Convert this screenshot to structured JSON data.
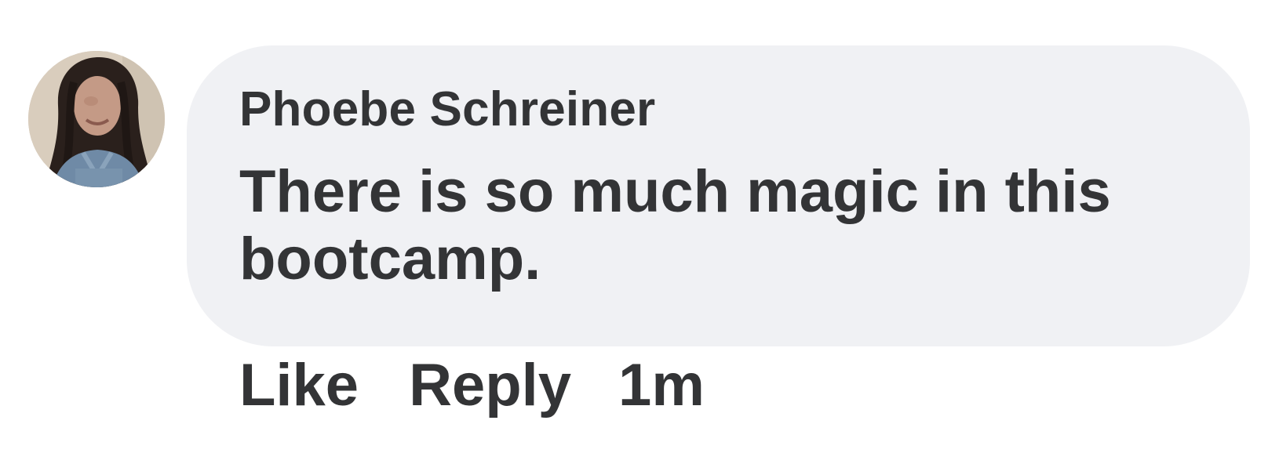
{
  "comment": {
    "author": "Phoebe Schreiner",
    "text": "There is so much magic in this bootcamp.",
    "actions": {
      "like_label": "Like",
      "reply_label": "Reply"
    },
    "timestamp": "1m"
  },
  "colors": {
    "bubble_background": "#f0f1f4",
    "text": "#333436",
    "page_background": "#ffffff"
  }
}
